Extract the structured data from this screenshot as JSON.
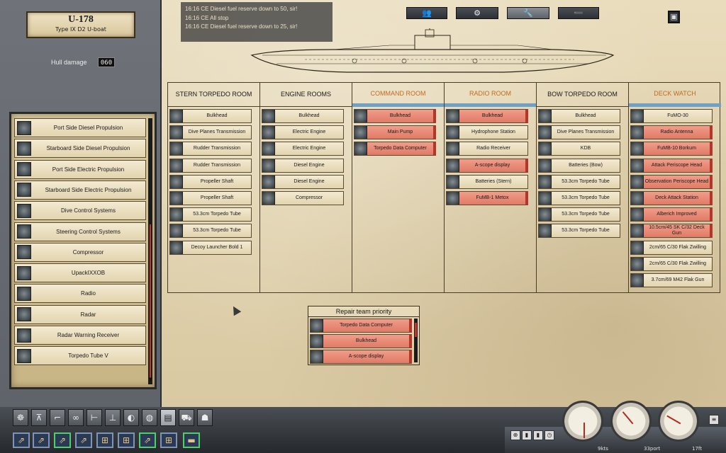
{
  "boat": {
    "name": "U-178",
    "type": "Type IX D2 U-boat"
  },
  "hull": {
    "label": "Hull damage",
    "value": "060"
  },
  "systems": [
    {
      "label": "Port Side Diesel Propulsion"
    },
    {
      "label": "Starboard Side Diesel Propulsion"
    },
    {
      "label": "Port Side Electric Propulsion"
    },
    {
      "label": "Starboard Side Electric Propulsion"
    },
    {
      "label": "Dive Control Systems"
    },
    {
      "label": "Steering Control Systems"
    },
    {
      "label": "Compressor"
    },
    {
      "label": "UpackIXXOB"
    },
    {
      "label": "Radio"
    },
    {
      "label": "Radar"
    },
    {
      "label": "Radar Warning Receiver"
    },
    {
      "label": "Torpedo Tube V"
    }
  ],
  "log": [
    "16:16 CE Diesel fuel reserve down to 50, sir!",
    "16:16 CE All stop",
    "16:16 CE Diesel fuel reserve down to 25, sir!"
  ],
  "tabs": [
    {
      "name": "crew",
      "icon": "👥"
    },
    {
      "name": "gears",
      "icon": "⚙"
    },
    {
      "name": "repair",
      "icon": "🔧"
    },
    {
      "name": "torpedo",
      "icon": "➖"
    }
  ],
  "compartments": [
    {
      "title": "STERN TORPEDO ROOM",
      "alert": false,
      "items": [
        {
          "label": "Bulkhead",
          "damaged": false
        },
        {
          "label": "Dive Planes Transmission",
          "damaged": false
        },
        {
          "label": "Rudder Transmission",
          "damaged": false
        },
        {
          "label": "Rudder Transmission",
          "damaged": false
        },
        {
          "label": "Propeller Shaft",
          "damaged": false
        },
        {
          "label": "Propeller Shaft",
          "damaged": false
        },
        {
          "label": "53.3cm Torpedo Tube",
          "damaged": false
        },
        {
          "label": "53.3cm Torpedo Tube",
          "damaged": false
        },
        {
          "label": "Decoy Launcher Bold 1",
          "damaged": false
        }
      ]
    },
    {
      "title": "ENGINE ROOMS",
      "alert": false,
      "items": [
        {
          "label": "Bulkhead",
          "damaged": false
        },
        {
          "label": "Electric Engine",
          "damaged": false
        },
        {
          "label": "Electric Engine",
          "damaged": false
        },
        {
          "label": "Diesel Engine",
          "damaged": false
        },
        {
          "label": "Diesel Engine",
          "damaged": false
        },
        {
          "label": "Compressor",
          "damaged": false
        }
      ]
    },
    {
      "title": "COMMAND ROOM",
      "alert": true,
      "items": [
        {
          "label": "Bulkhead",
          "damaged": true
        },
        {
          "label": "Main Pump",
          "damaged": true
        },
        {
          "label": "Torpedo Data Computer",
          "damaged": true
        }
      ]
    },
    {
      "title": "RADIO ROOM",
      "alert": true,
      "items": [
        {
          "label": "Bulkhead",
          "damaged": true
        },
        {
          "label": "Hydrophone Station",
          "damaged": false
        },
        {
          "label": "Radio Receiver",
          "damaged": false
        },
        {
          "label": "A-scope display",
          "damaged": true
        },
        {
          "label": "Batteries (Stern)",
          "damaged": false
        },
        {
          "label": "FuMB-1 Metox",
          "damaged": true
        }
      ]
    },
    {
      "title": "BOW TORPEDO ROOM",
      "alert": false,
      "items": [
        {
          "label": "Bulkhead",
          "damaged": false
        },
        {
          "label": "Dive Planes Transmission",
          "damaged": false
        },
        {
          "label": "KDB",
          "damaged": false
        },
        {
          "label": "Batteries (Bow)",
          "damaged": false
        },
        {
          "label": "53.3cm Torpedo Tube",
          "damaged": false
        },
        {
          "label": "53.3cm Torpedo Tube",
          "damaged": false
        },
        {
          "label": "53.3cm Torpedo Tube",
          "damaged": false
        },
        {
          "label": "53.3cm Torpedo Tube",
          "damaged": false
        }
      ]
    },
    {
      "title": "DECK WATCH",
      "alert": true,
      "items": [
        {
          "label": "FuMO-30",
          "damaged": false
        },
        {
          "label": "Radio Antenna",
          "damaged": true
        },
        {
          "label": "FuMB-10 Borkum",
          "damaged": true
        },
        {
          "label": "Attack Periscope Head",
          "damaged": true
        },
        {
          "label": "Observation Periscope Head",
          "damaged": true
        },
        {
          "label": "Deck Attack Station",
          "damaged": true
        },
        {
          "label": "Alberich Improved",
          "damaged": true
        },
        {
          "label": "10.5cm/45 SK C/32 Deck Gun",
          "damaged": true
        },
        {
          "label": "2cm/65 C/30 Flak Zwilling",
          "damaged": false
        },
        {
          "label": "2cm/65 C/30 Flak Zwilling",
          "damaged": false
        },
        {
          "label": "3.7cm/69 M42 Flak Gun",
          "damaged": false
        }
      ]
    }
  ],
  "repair_priority": {
    "title": "Repair team priority",
    "items": [
      {
        "label": "Torpedo Data Computer"
      },
      {
        "label": "Bulkhead"
      },
      {
        "label": "A-scope display"
      }
    ]
  },
  "gauges": [
    {
      "label": "9kts"
    },
    {
      "label": "33port"
    },
    {
      "label": "17ft"
    }
  ]
}
